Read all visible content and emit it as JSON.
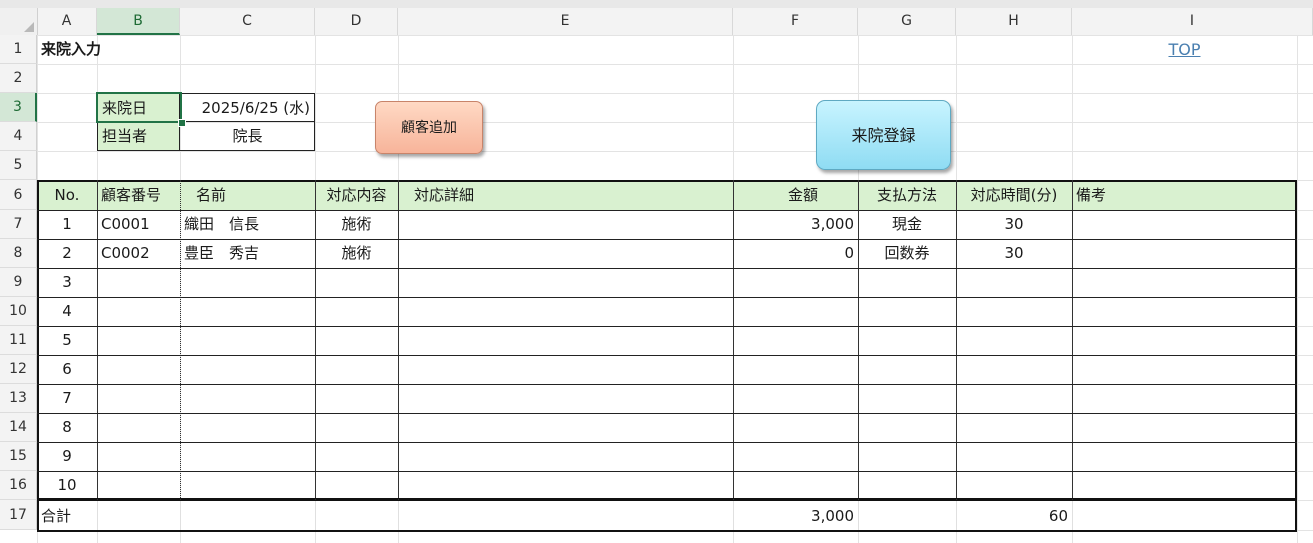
{
  "columns": [
    "A",
    "B",
    "C",
    "D",
    "E",
    "F",
    "G",
    "H",
    "I"
  ],
  "selected_column": "B",
  "rows": [
    "1",
    "2",
    "3",
    "4",
    "5",
    "6",
    "7",
    "8",
    "9",
    "10",
    "11",
    "12",
    "13",
    "14",
    "15",
    "16",
    "17"
  ],
  "selected_row": "3",
  "title": "来院入力",
  "top_link": "TOP",
  "visit_date_label": "来院日",
  "visit_date_value": "2025/6/25 (水)",
  "staff_label": "担当者",
  "staff_value": "院長",
  "add_customer_button": "顧客追加",
  "register_visit_button": "来院登録",
  "table": {
    "headers": [
      "No.",
      "顧客番号",
      "名前",
      "対応内容",
      "対応詳細",
      "金額",
      "支払方法",
      "対応時間(分)",
      "備考"
    ],
    "rows": [
      [
        "1",
        "C0001",
        "織田　信長",
        "施術",
        "",
        "3,000",
        "現金",
        "30",
        ""
      ],
      [
        "2",
        "C0002",
        "豊臣　秀吉",
        "施術",
        "",
        "0",
        "回数券",
        "30",
        ""
      ],
      [
        "3",
        "",
        "",
        "",
        "",
        "",
        "",
        "",
        ""
      ],
      [
        "4",
        "",
        "",
        "",
        "",
        "",
        "",
        "",
        ""
      ],
      [
        "5",
        "",
        "",
        "",
        "",
        "",
        "",
        "",
        ""
      ],
      [
        "6",
        "",
        "",
        "",
        "",
        "",
        "",
        "",
        ""
      ],
      [
        "7",
        "",
        "",
        "",
        "",
        "",
        "",
        "",
        ""
      ],
      [
        "8",
        "",
        "",
        "",
        "",
        "",
        "",
        "",
        ""
      ],
      [
        "9",
        "",
        "",
        "",
        "",
        "",
        "",
        "",
        ""
      ],
      [
        "10",
        "",
        "",
        "",
        "",
        "",
        "",
        "",
        ""
      ]
    ],
    "total_label": "合計",
    "total_amount": "3,000",
    "total_time": "60"
  },
  "colors": {
    "header_fill": "#d9f1d0",
    "selection": "#217346",
    "add_button": "#f9c1a8",
    "register_button": "#a8e6f7"
  }
}
